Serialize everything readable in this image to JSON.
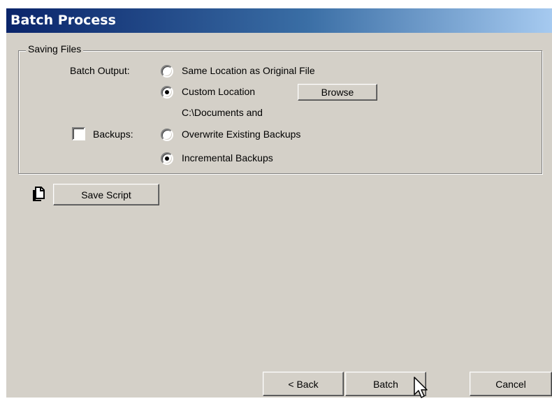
{
  "window": {
    "title": "Batch Process"
  },
  "saving_files": {
    "legend": "Saving Files",
    "batch_output_label": "Batch Output:",
    "option_same_location": "Same Location as Original File",
    "option_custom_location": "Custom Location",
    "browse_label": "Browse",
    "custom_path": "C:\\Documents and",
    "backups_label": "Backups:",
    "backups_checked": false,
    "option_overwrite": "Overwrite Existing Backups",
    "option_incremental": "Incremental Backups",
    "selected_output": "Custom Location",
    "selected_backup": "Incremental Backups"
  },
  "script": {
    "save_script_label": "Save Script",
    "icon": "copy-icon"
  },
  "footer": {
    "back_label": "< Back",
    "batch_label": "Batch",
    "cancel_label": "Cancel"
  }
}
